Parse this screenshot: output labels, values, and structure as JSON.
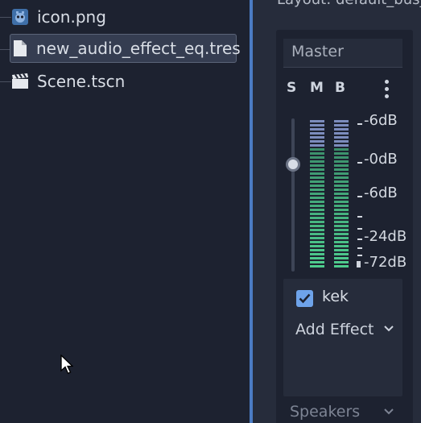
{
  "file_tree": {
    "items": [
      {
        "name": "icon.png",
        "icon": "godot-image-icon",
        "selected": false
      },
      {
        "name": "new_audio_effect_eq.tres",
        "icon": "file-icon",
        "selected": true
      },
      {
        "name": "Scene.tscn",
        "icon": "clapperboard-icon",
        "selected": false
      }
    ]
  },
  "audio_panel": {
    "layout_label": "Layout: default_bus_layout.tres",
    "bus": {
      "name": "Master",
      "solo": "S",
      "mute": "M",
      "bypass": "B",
      "volume_db": 0,
      "db_labels": [
        "-6dB",
        "-0dB",
        "-6dB",
        "-24dB",
        "-72dB"
      ],
      "effects": [
        {
          "name": "kek",
          "enabled": true
        }
      ],
      "add_effect_label": "Add Effect"
    },
    "next_bus_name": "Speakers"
  },
  "colors": {
    "accent": "#4b7cc3",
    "meter_green": "#4fcf8f",
    "meter_blue": "#8d9fd6",
    "checkbox": "#6ea3ea"
  }
}
